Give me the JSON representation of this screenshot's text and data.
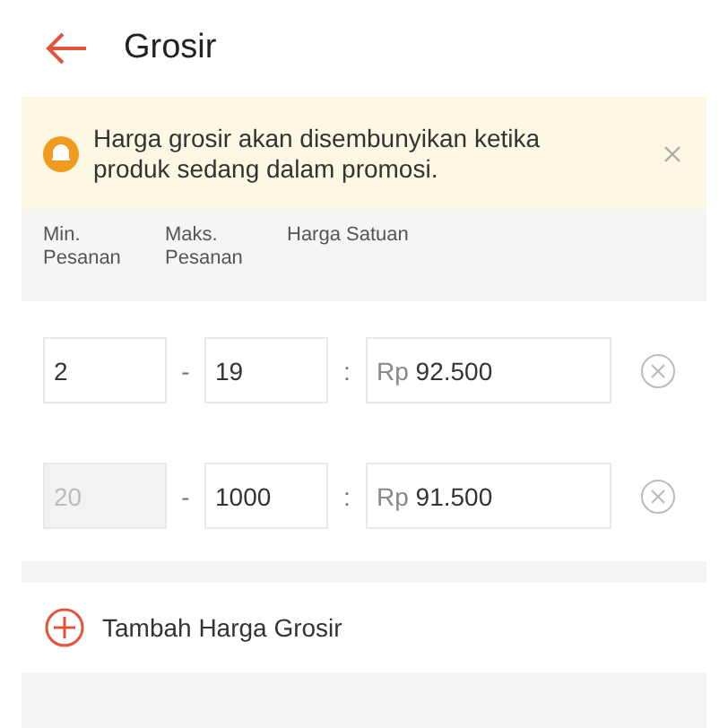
{
  "header": {
    "title": "Grosir"
  },
  "notice": {
    "text": "Harga grosir akan disembunyikan ketika produk sedang dalam promosi."
  },
  "columns": [
    "Min. Pesanan",
    "Maks. Pesanan",
    "Harga Satuan"
  ],
  "tiers": [
    {
      "min": "2",
      "min_disabled": false,
      "range_sep": "-",
      "max": "19",
      "price_sep": ":",
      "currency": "Rp",
      "price": "92.500"
    },
    {
      "min": "20",
      "min_disabled": true,
      "range_sep": "-",
      "max": "1000",
      "price_sep": ":",
      "currency": "Rp",
      "price": "91.500"
    }
  ],
  "add_button": {
    "label": "Tambah Harga Grosir"
  }
}
